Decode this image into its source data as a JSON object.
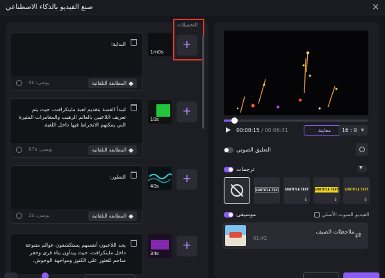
{
  "window": {
    "title": "صنع الفيديو بالذكاء الاصطناعي",
    "close": "×"
  },
  "uploads": {
    "label": "التحميلات",
    "add": "+"
  },
  "scenes": [
    {
      "text": "البداية:",
      "voice": "يوصى: 4s",
      "match": "المطابقة التلقائية",
      "duration": "1m0s",
      "add": "+"
    },
    {
      "text": "لنبدأ القصة بتقديم لعبة ماينكرافت، حيث يتم تعريف اللاعبين بالعالم الرهيب والمغامرات المثيرة التي يمكنهم الانخراط فيها داخل اللعبة.",
      "voice": "يوصى: 67s",
      "match": "المطابقة التلقائية",
      "duration": "10s",
      "add": "+"
    },
    {
      "text": "التطور:",
      "voice": "يوصى: 3s",
      "match": "المطابقة التلقائية",
      "duration": "40s",
      "add": "+"
    },
    {
      "text": "يجد اللاعبون أنفسهم يستكشفون عوالم متنوعة داخل ماينكرافت، حيث يبدأون بناء قرى وحفر مناجم للعثور على الكنوز ومواجهة الوحوش.",
      "voice": "",
      "match": "",
      "duration": "34s",
      "add": "+"
    }
  ],
  "player": {
    "current": "00:00:15",
    "total": "/ 00:06:31",
    "preview": "معاينة",
    "ratio": "16 : 9",
    "progress_fraction": 0.06
  },
  "voiceover": {
    "label": "التعليق الصوتي",
    "enabled": false
  },
  "subtitles": {
    "label": "ترجمات",
    "enabled": true,
    "styles": [
      {
        "text": "",
        "none": true
      },
      {
        "text": "SUBTITLE TEXT",
        "color": "#e8e8e8",
        "bg": ""
      },
      {
        "text": "SUBTITLE TEXT",
        "color": "#ffffff",
        "bg": ""
      },
      {
        "text": "SUBTITLE TEXT",
        "color": "#1a1a1a",
        "bg": "#f2d51c"
      },
      {
        "text": "SUBTITLE TEXT",
        "color": "#f2d51c",
        "bg": ""
      }
    ]
  },
  "music": {
    "label": "موسيقى",
    "enabled": true,
    "original_audio": "الفيديو الصوت الأصلي",
    "original_audio_checked": false,
    "track_title": "ملاحظات الصيف",
    "track_duration": "01:42"
  },
  "colors": {
    "accent": "#8a5cf6",
    "highlight": "#e0352b",
    "panel": "#1d1e24"
  }
}
